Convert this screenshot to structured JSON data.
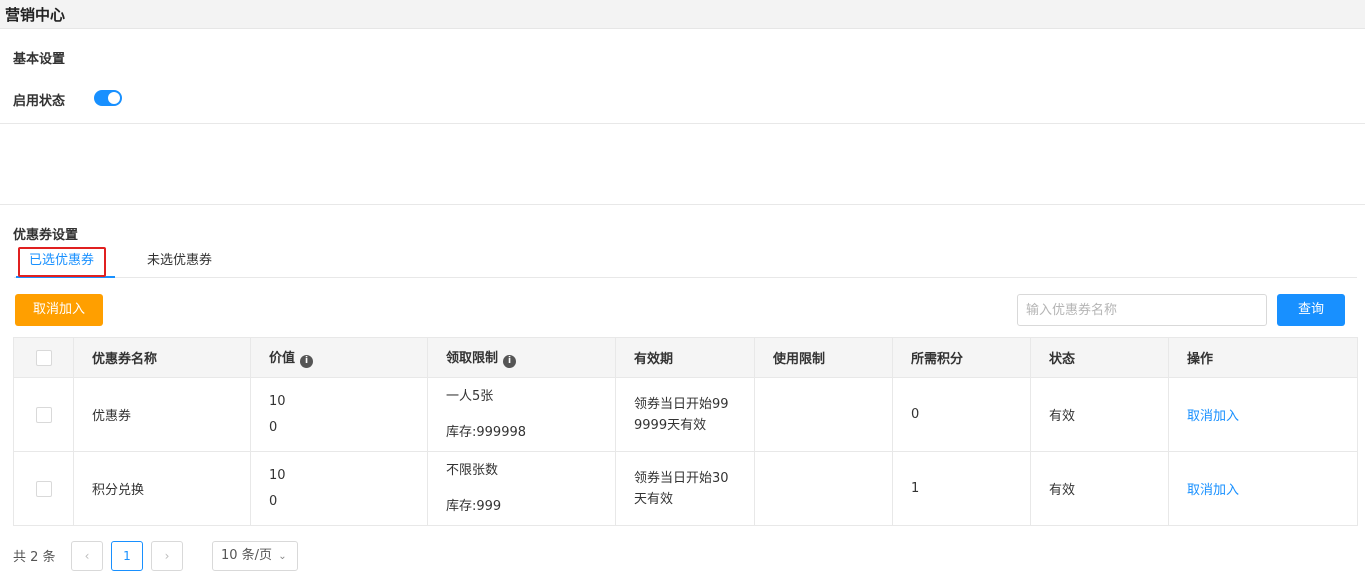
{
  "header": {
    "title": "营销中心"
  },
  "basic": {
    "section_title": "基本设置",
    "enable_label": "启用状态",
    "enabled": true
  },
  "coupon": {
    "section_title": "优惠券设置",
    "tabs": [
      {
        "label": "已选优惠券",
        "active": true
      },
      {
        "label": "未选优惠券",
        "active": false
      }
    ],
    "remove_button": "取消加入",
    "search_placeholder": "输入优惠券名称",
    "search_button": "查询",
    "columns": [
      "优惠券名称",
      "价值",
      "领取限制",
      "有效期",
      "使用限制",
      "所需积分",
      "状态",
      "操作"
    ],
    "rows": [
      {
        "name": "优惠券",
        "value_line1": "10",
        "value_line2": "0",
        "limit": "一人5张",
        "stock": "库存:999998",
        "validity": "领券当日开始999999天有效",
        "usage": "",
        "points": "0",
        "status": "有效",
        "action": "取消加入"
      },
      {
        "name": "积分兑换",
        "value_line1": "10",
        "value_line2": "0",
        "limit": "不限张数",
        "stock": "库存:999",
        "validity": "领券当日开始30天有效",
        "usage": "",
        "points": "1",
        "status": "有效",
        "action": "取消加入"
      }
    ]
  },
  "pagination": {
    "total": "共 2 条",
    "current_page": "1",
    "prev": "‹",
    "next": "›",
    "page_size": "10 条/页"
  },
  "colors": {
    "primary": "#1890ff",
    "warning": "#ff9f00",
    "highlight": "#e02020"
  }
}
